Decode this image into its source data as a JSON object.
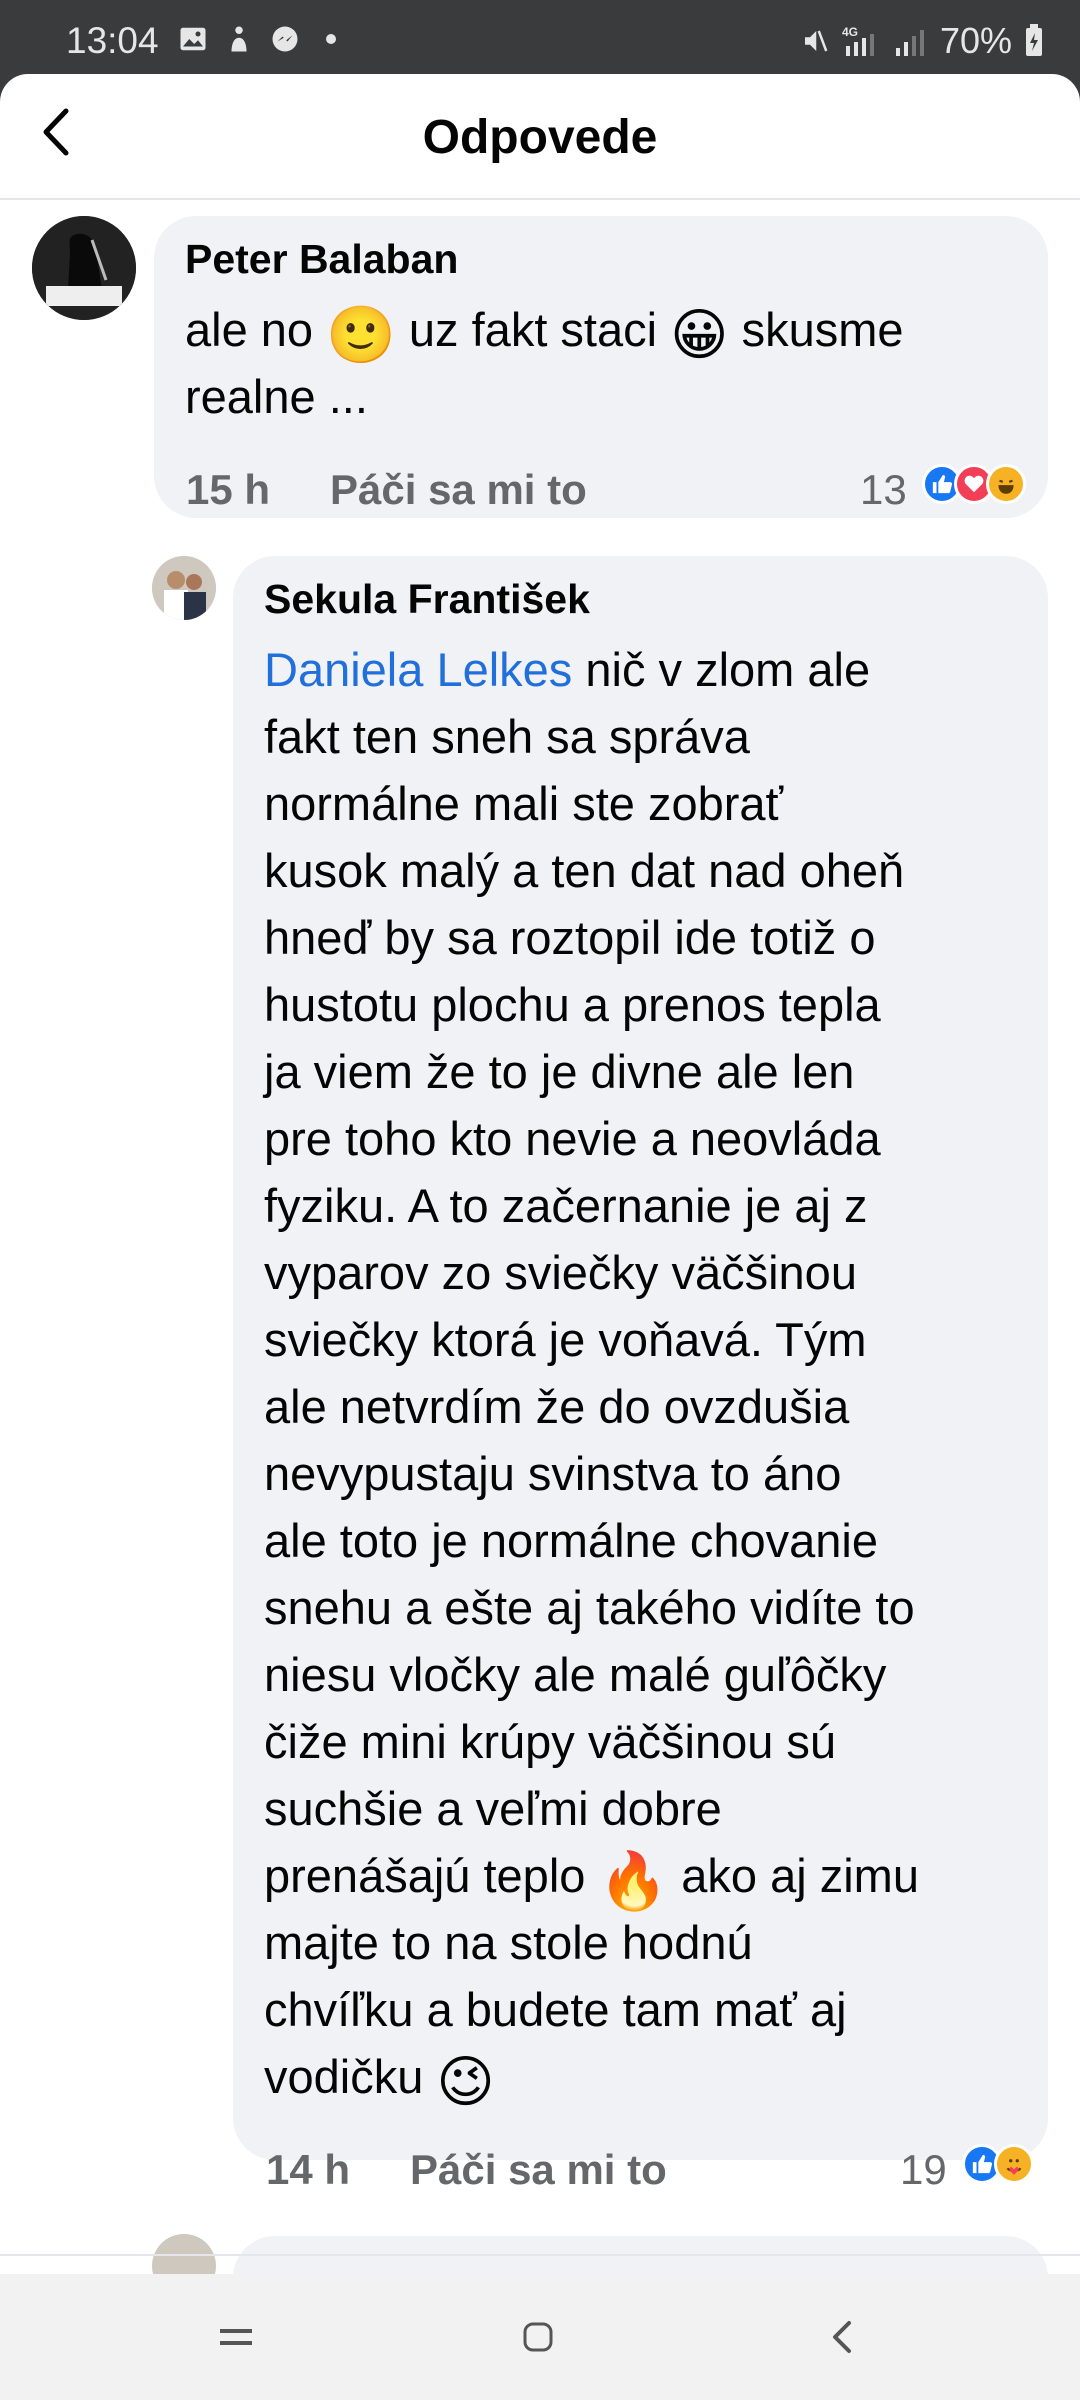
{
  "status_bar": {
    "time": "13:04",
    "network": "4G",
    "battery": "70%"
  },
  "header": {
    "title": "Odpovede",
    "back_icon": "chevron-left-icon"
  },
  "comments": [
    {
      "author": "Peter Balaban",
      "lines": [
        "ale no",
        "uz fakt staci",
        "skusme",
        "realne ..."
      ],
      "emoji": [
        "🙂",
        "😀"
      ],
      "time": "15 h",
      "like_label": "Páči sa mi to",
      "reaction_count": "13",
      "reactions": [
        "like-icon",
        "love-icon",
        "haha-icon"
      ]
    },
    {
      "author": "Sekula František",
      "mention": "Daniela Lelkes",
      "lines": [
        " nič v zlom ale",
        "fakt ten sneh sa správa",
        "normálne mali ste zobrať",
        "kusok malý a ten dat nad oheň",
        "hneď by sa roztopil ide totiž o",
        "hustotu plochu a prenos tepla",
        "ja viem že to je divne ale len",
        "pre toho kto nevie a neovláda",
        "fyziku. A to začernanie je aj z",
        "vyparov zo sviečky väčšinou",
        "sviečky ktorá je voňavá. Tým",
        "ale netvrdím že do ovzdušia",
        "nevypustaju svinstva to áno",
        "ale toto je normálne chovanie",
        "snehu a ešte aj takého vidíte to",
        "niesu vločky ale malé guľôčky",
        "čiže mini krúpy väčšinou sú",
        "suchšie a veľmi dobre",
        "prenášajú teplo",
        "ako aj zimu",
        "majte to na stole hodnú",
        "chvíľku a budete tam mať aj",
        "vodičku"
      ],
      "emoji": [
        "🔥",
        "😉"
      ],
      "time": "14 h",
      "like_label": "Páči sa mi to",
      "reaction_count": "19",
      "reactions": [
        "like-icon",
        "care-icon"
      ]
    }
  ],
  "colors": {
    "accent": "#216fdb",
    "like": "#1877f2",
    "love": "#f33e58",
    "haha": "#f7b125",
    "bubble": "#f0f2f5",
    "muted": "#65676b"
  }
}
